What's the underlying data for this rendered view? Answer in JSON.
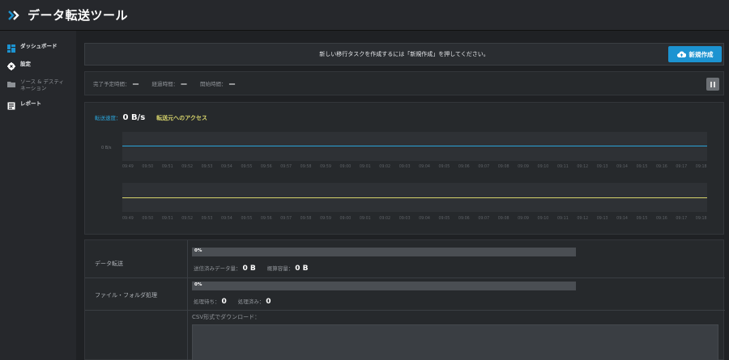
{
  "app": {
    "title": "データ転送ツール"
  },
  "sidebar": {
    "items": [
      {
        "label": "ダッシュボード",
        "icon": "dashboard-icon"
      },
      {
        "label": "設定",
        "icon": "gear-icon"
      },
      {
        "label": "ソース & デスティネーション",
        "icon": "folder-icon"
      },
      {
        "label": "レポート",
        "icon": "report-icon"
      }
    ]
  },
  "banner": {
    "message": "新しい移行タスクを作成するには「新規作成」を押してください。",
    "new_button": "新規作成"
  },
  "timebar": {
    "eta_label": "完了予定時間：",
    "eta_value": "—",
    "elapsed_label": "経過時間：",
    "elapsed_value": "—",
    "start_label": "開始時間：",
    "start_value": "—"
  },
  "chart": {
    "speed_label": "転送速度：",
    "speed_value": "0 B/s",
    "access_label": "転送元へのアクセス",
    "y_label": "0 B/s",
    "ticks": [
      "09:49",
      "09:50",
      "09:51",
      "09:52",
      "09:53",
      "09:54",
      "09:55",
      "09:56",
      "09:57",
      "09:58",
      "09:59",
      "09:00",
      "09:01",
      "09:02",
      "09:03",
      "09:04",
      "09:05",
      "09:06",
      "09:07",
      "09:08",
      "09:09",
      "09:10",
      "09:11",
      "09:12",
      "09:13",
      "09:14",
      "09:15",
      "09:16",
      "09:17",
      "09:18"
    ]
  },
  "chart_data": {
    "type": "line",
    "title": "",
    "xlabel": "",
    "ylabel": "",
    "x": [
      "09:49",
      "09:50",
      "09:51",
      "09:52",
      "09:53",
      "09:54",
      "09:55",
      "09:56",
      "09:57",
      "09:58",
      "09:59",
      "09:00",
      "09:01",
      "09:02",
      "09:03",
      "09:04",
      "09:05",
      "09:06",
      "09:07",
      "09:08",
      "09:09",
      "09:10",
      "09:11",
      "09:12",
      "09:13",
      "09:14",
      "09:15",
      "09:16",
      "09:17",
      "09:18"
    ],
    "series": [
      {
        "name": "転送速度",
        "values": [
          0,
          0,
          0,
          0,
          0,
          0,
          0,
          0,
          0,
          0,
          0,
          0,
          0,
          0,
          0,
          0,
          0,
          0,
          0,
          0,
          0,
          0,
          0,
          0,
          0,
          0,
          0,
          0,
          0,
          0
        ]
      },
      {
        "name": "転送元へのアクセス",
        "values": [
          0,
          0,
          0,
          0,
          0,
          0,
          0,
          0,
          0,
          0,
          0,
          0,
          0,
          0,
          0,
          0,
          0,
          0,
          0,
          0,
          0,
          0,
          0,
          0,
          0,
          0,
          0,
          0,
          0,
          0
        ]
      }
    ],
    "grid": false,
    "legend": "top-left"
  },
  "transfer": {
    "label": "データ転送",
    "progress_text": "0%",
    "progress": 0,
    "sent_label": "送信済みデータ量：",
    "sent_value": "0 B",
    "total_label": "概算容量：",
    "total_value": "0 B"
  },
  "files": {
    "label": "ファイル・フォルダ処理",
    "progress_text": "0%",
    "progress": 0,
    "pending_label": "処理待ち：",
    "pending_value": "0",
    "done_label": "処理済み：",
    "done_value": "0"
  },
  "csv": {
    "label": "CSV形式でダウンロード："
  },
  "colors": {
    "accent": "#1c93d1",
    "speed_line": "#2aa3d8",
    "access_line": "#d6d36b"
  }
}
